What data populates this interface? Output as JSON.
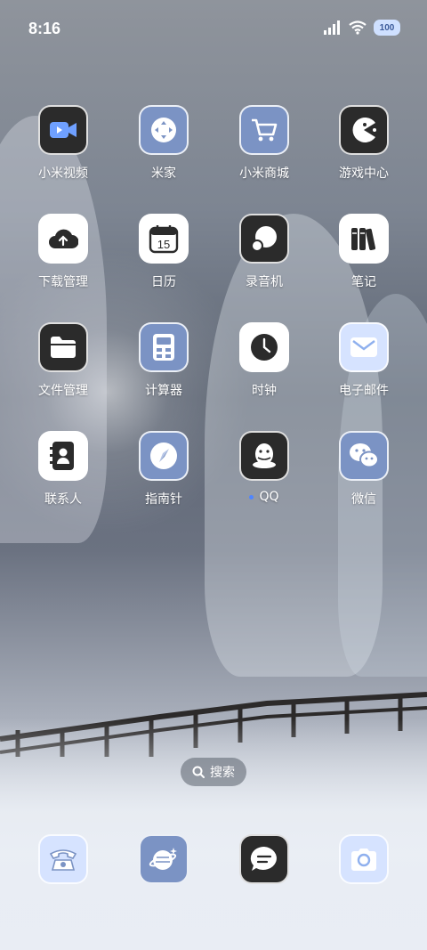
{
  "status_bar": {
    "time": "8:16",
    "battery": "100"
  },
  "apps": {
    "r1": [
      "小米视频",
      "米家",
      "小米商城",
      "游戏中心"
    ],
    "r2": [
      "下载管理",
      "日历",
      "录音机",
      "笔记"
    ],
    "r3": [
      "文件管理",
      "计算器",
      "时钟",
      "电子邮件"
    ],
    "r4": [
      "联系人",
      "指南针",
      "QQ",
      "微信"
    ]
  },
  "calendar_day": "15",
  "search": {
    "label": "搜索"
  },
  "dock": [
    "phone-icon",
    "planet-icon",
    "messages-icon",
    "camera-icon"
  ],
  "colors": {
    "accent": "#4f86ff",
    "icon_blue": "#7b93c4",
    "icon_dark": "#2b2b2b",
    "icon_light": "#d6e3ff"
  }
}
